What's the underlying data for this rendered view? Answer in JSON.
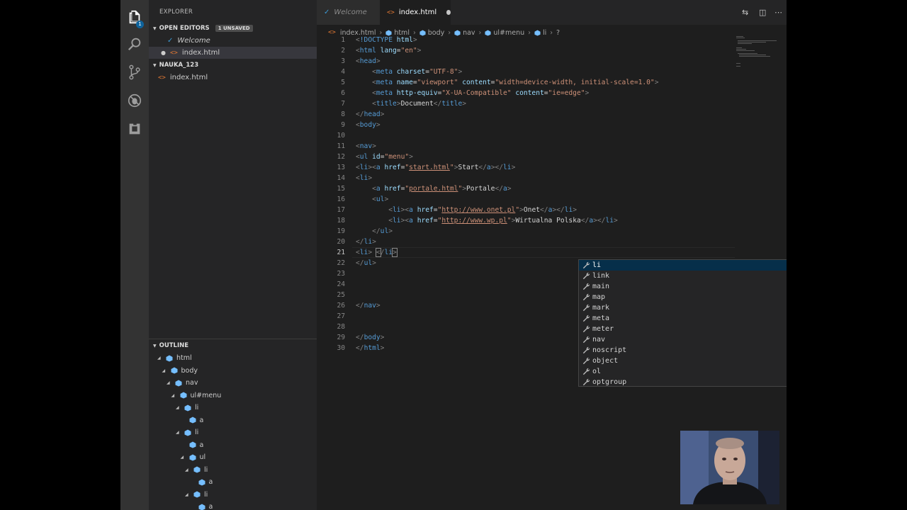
{
  "colors": {
    "accent": "#007acc",
    "activity_bg": "#333333",
    "sidebar_bg": "#252526",
    "editor_bg": "#1e1e1e"
  },
  "activity_bar": {
    "items": [
      {
        "icon": "files-icon",
        "badge": "1"
      },
      {
        "icon": "search-icon"
      },
      {
        "icon": "source-control-icon"
      },
      {
        "icon": "debug-icon"
      },
      {
        "icon": "extensions-icon"
      }
    ]
  },
  "sidebar": {
    "title": "EXPLORER",
    "open_editors": {
      "label": "OPEN EDITORS",
      "badge": "1 UNSAVED",
      "items": [
        {
          "label": "Welcome",
          "icon": "vscode-icon"
        },
        {
          "label": "index.html",
          "icon": "html-file-icon"
        }
      ]
    },
    "workspace": {
      "label": "NAUKA_123",
      "items": [
        {
          "label": "index.html",
          "icon": "html-file-icon"
        }
      ]
    },
    "outline": {
      "label": "OUTLINE",
      "items": [
        {
          "label": "html",
          "depth": 0
        },
        {
          "label": "body",
          "depth": 1
        },
        {
          "label": "nav",
          "depth": 2
        },
        {
          "label": "ul#menu",
          "depth": 3
        },
        {
          "label": "li",
          "depth": 4
        },
        {
          "label": "a",
          "depth": 5
        },
        {
          "label": "li",
          "depth": 4
        },
        {
          "label": "a",
          "depth": 5
        },
        {
          "label": "ul",
          "depth": 5
        },
        {
          "label": "li",
          "depth": 6
        },
        {
          "label": "a",
          "depth": 7
        },
        {
          "label": "li",
          "depth": 6
        },
        {
          "label": "a",
          "depth": 7
        }
      ]
    }
  },
  "tabs": [
    {
      "label": "Welcome",
      "active": false
    },
    {
      "label": "index.html",
      "active": true,
      "dirty": true
    }
  ],
  "breadcrumb": [
    "index.html",
    "html",
    "body",
    "nav",
    "ul#menu",
    "li",
    "?"
  ],
  "editor": {
    "line_numbers": [
      "1",
      "2",
      "3",
      "4",
      "5",
      "6",
      "7",
      "8",
      "9",
      "10",
      "11",
      "12",
      "13",
      "14",
      "15",
      "16",
      "17",
      "18",
      "19",
      "20",
      "21",
      "22",
      "23",
      "24",
      "25",
      "26",
      "27",
      "28",
      "29",
      "30"
    ],
    "current_line": 21
  },
  "suggest": {
    "items": [
      "li",
      "link",
      "main",
      "map",
      "mark",
      "meta",
      "meter",
      "nav",
      "noscript",
      "object",
      "ol",
      "optgroup"
    ],
    "selected": 0
  }
}
